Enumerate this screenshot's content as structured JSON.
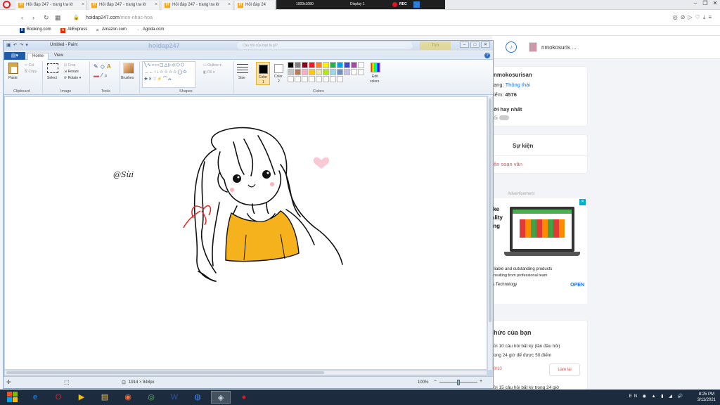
{
  "browser": {
    "tabs": [
      {
        "label": "Hỏi đáp 247 - trang tra lờ"
      },
      {
        "label": "Hỏi đáp 247 - trang tra lờ"
      },
      {
        "label": "Hỏi đáp 247 - trang tra lờ"
      },
      {
        "label": "Hỏi đáp 24"
      }
    ],
    "tab_fav": "H",
    "tab_close": "×",
    "recorder": {
      "resolution": "1920x1080",
      "display": "Display 1",
      "rec": "REC"
    },
    "url_host": "hoidap247.com",
    "url_path": "/mon-nhac-hoa",
    "bookmarks": [
      {
        "label": "Booking.com",
        "color": "#003580"
      },
      {
        "label": "AliExpress",
        "color": "#e62e04"
      },
      {
        "label": "Amazon.com",
        "color": "#222222"
      },
      {
        "label": "Agoda.com",
        "color": "#5c2d91"
      }
    ]
  },
  "website": {
    "username": "nmokosuris ...",
    "profile": {
      "name": "nmokosurisan",
      "rank_prefix": "ạng:",
      "rank": "Thông thái",
      "points_prefix": "iểm:",
      "points": "4576",
      "best_answer": "ời hay nhất",
      "best_answer_2": "ối"
    },
    "event": {
      "title": "Sự kiện",
      "link": "ên soạn văn"
    },
    "ad": {
      "label": "Advertisement",
      "headline_1": "ike",
      "headline_2": "ality",
      "headline_3": "ing",
      "text_1": "eliable and outstanding products",
      "text_2": "onsulting from professional team",
      "text_3": "is Technology",
      "open": "OPEN",
      "close": "✕"
    },
    "challenge": {
      "title": "hức của bạn",
      "line_1": "ời 10 câu hỏi bất kỳ (lần đầu hỏi)",
      "line_2": "ong 24 giờ để được 50 điểm",
      "progress": "0/10",
      "button": "Làm lại",
      "line_3": "ời 15 câu hỏi bất kỳ trong 24 giờ"
    }
  },
  "paint": {
    "title": "Untitled - Paint",
    "ghost_site": "hoidap247",
    "ghost_search": "Câu hỏi của bạn là gì?",
    "ghost_button": "Tìm",
    "tabs": {
      "home": "Home",
      "view": "View"
    },
    "groups": {
      "clipboard": "Clipboard",
      "image": "Image",
      "tools": "Tools",
      "shapes": "Shapes",
      "colors": "Colors"
    },
    "buttons": {
      "paste": "Paste",
      "cut": "Cut",
      "copy": "Copy",
      "select": "Select",
      "crop": "Crop",
      "resize": "Resize",
      "rotate": "Rotate",
      "brushes": "Brushes",
      "outline": "Outline",
      "fill": "Fill",
      "size": "Size",
      "color1_a": "Color",
      "color1_b": "1",
      "color2_a": "Color",
      "color2_b": "2",
      "edit_colors_a": "Edit",
      "edit_colors_b": "colors"
    },
    "palette": [
      "#000000",
      "#7f7f7f",
      "#880015",
      "#ed1c24",
      "#ff7f27",
      "#fff200",
      "#22b14c",
      "#00a2e8",
      "#3f48cc",
      "#a349a4",
      "#ffffff",
      "#c3c3c3",
      "#b97a57",
      "#ffaec9",
      "#ffc90e",
      "#efe4b0",
      "#b5e61d",
      "#99d9ea",
      "#7092be",
      "#c8bfe7",
      "#ffffff",
      "#ffffff",
      "#ffffff",
      "#ffffff",
      "#ffffff",
      "#ffffff",
      "#ffffff",
      "#ffffff",
      "#ffffff",
      "#ffffff"
    ],
    "canvas_text": "@Sùi",
    "status": {
      "dimensions": "1914 × 848px",
      "zoom": "100%",
      "zoom_out": "−",
      "zoom_in": "+",
      "zoom_level": 0.5
    }
  },
  "taskbar": {
    "apps": [
      {
        "name": "internet-explorer",
        "glyph": "e"
      },
      {
        "name": "opera",
        "glyph": "O"
      },
      {
        "name": "media-player",
        "glyph": "▶"
      },
      {
        "name": "file-explorer",
        "glyph": "▤"
      },
      {
        "name": "firefox",
        "glyph": "◉"
      },
      {
        "name": "vpn",
        "glyph": "◎"
      },
      {
        "name": "word",
        "glyph": "W"
      },
      {
        "name": "chrome",
        "glyph": "◍"
      },
      {
        "name": "paint",
        "glyph": "◈"
      },
      {
        "name": "recorder",
        "glyph": "●"
      }
    ],
    "tray": "EN",
    "time": "8:25 PM",
    "date": "3/11/2021"
  }
}
